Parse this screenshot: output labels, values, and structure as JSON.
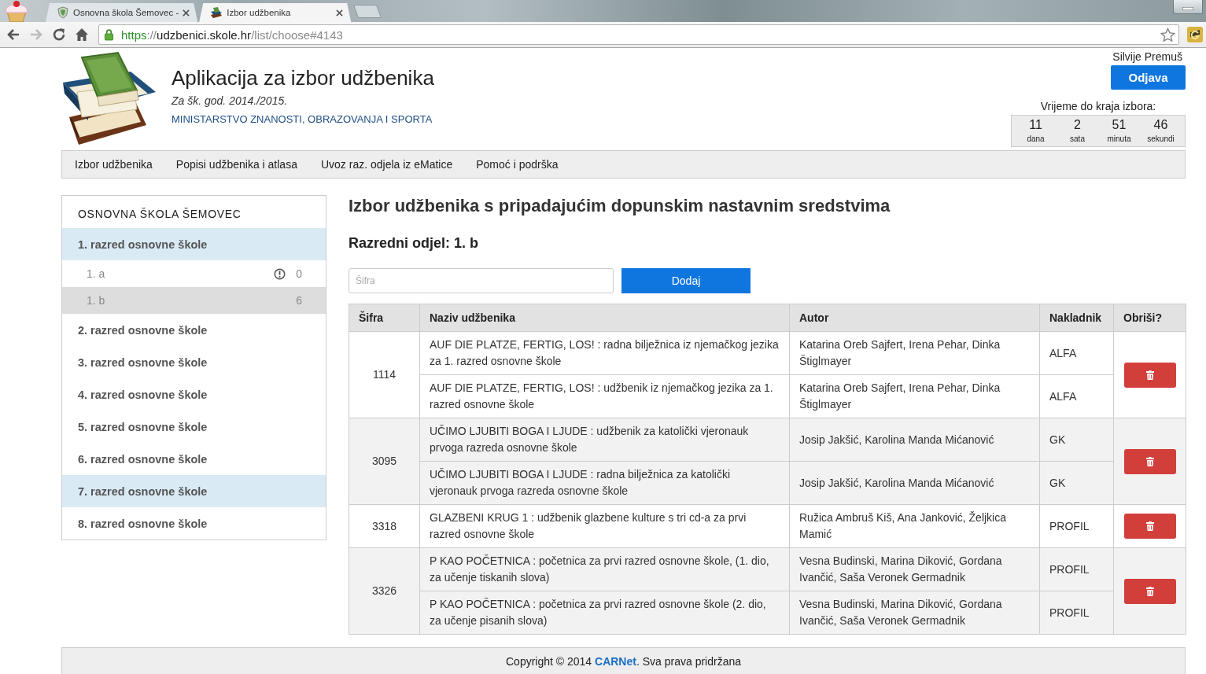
{
  "browser": {
    "tabs": [
      {
        "title": "Osnovna škola Šemovec -",
        "selected": false
      },
      {
        "title": "Izbor udžbenika",
        "selected": true
      }
    ],
    "nav_buttons": [
      {
        "kind": "back",
        "disabled": false
      },
      {
        "kind": "forward",
        "disabled": true
      },
      {
        "kind": "reload",
        "disabled": false
      },
      {
        "kind": "home",
        "disabled": false
      }
    ],
    "url": "https://udzbenici.skole.hr/list/choose#4143"
  },
  "header": {
    "title": "Aplikacija za izbor udžbenika",
    "school_year": "Za šk. god. 2014./2015.",
    "ministry": "MINISTARSTVO ZNANOSTI, OBRAZOVANJA I SPORTA",
    "user_name": "Silvije Premuš",
    "logout_button": "Odjava",
    "countdown": {
      "label": "Vrijeme do kraja izbora:",
      "parts": [
        {
          "value": "11",
          "unit": "dana"
        },
        {
          "value": "2",
          "unit": "sata"
        },
        {
          "value": "51",
          "unit": "minuta"
        },
        {
          "value": "46",
          "unit": "sekundi"
        }
      ]
    }
  },
  "nav": {
    "items": [
      "Izbor udžbenika",
      "Popisi udžbenika i atlasa",
      "Uvoz raz. odjela iz eMatice",
      "Pomoć i podrška"
    ]
  },
  "sidebar": {
    "school": "OSNOVNA ŠKOLA ŠEMOVEC",
    "grades": [
      {
        "label": "1. razred osnovne škole",
        "highlighted": true,
        "children": [
          {
            "label": "1. a",
            "count": "0",
            "warning": true,
            "selected": false
          },
          {
            "label": "1. b",
            "count": "6",
            "warning": false,
            "selected": true
          }
        ]
      },
      {
        "label": "2. razred osnovne škole",
        "highlighted": false
      },
      {
        "label": "3. razred osnovne škole",
        "highlighted": false
      },
      {
        "label": "4. razred osnovne škole",
        "highlighted": false
      },
      {
        "label": "5. razred osnovne škole",
        "highlighted": false
      },
      {
        "label": "6. razred osnovne škole",
        "highlighted": false
      },
      {
        "label": "7. razred osnovne škole",
        "highlighted": true
      },
      {
        "label": "8. razred osnovne škole",
        "highlighted": false
      }
    ]
  },
  "main": {
    "heading": "Izbor udžbenika s pripadajućim dopunskim nastavnim sredstvima",
    "class_heading": "Razredni odjel: 1. b",
    "code_field": {
      "placeholder": "Šifra"
    },
    "add_button": "Dodaj",
    "table": {
      "columns": [
        "Šifra",
        "Naziv udžbenika",
        "Autor",
        "Nakladnik",
        "Obriši?"
      ],
      "groups": [
        {
          "code": "1114",
          "rows": [
            {
              "title": "AUF DIE PLATZE, FERTIG, LOS! : radna bilježnica iz njemačkog jezika za 1. razred osnovne škole",
              "author": "Katarina Oreb Sajfert, Irena Pehar, Dinka Štiglmayer",
              "publisher": "ALFA"
            },
            {
              "title": "AUF DIE PLATZE, FERTIG, LOS! : udžbenik iz njemačkog jezika za 1. razred osnovne škole",
              "author": "Katarina Oreb Sajfert, Irena Pehar, Dinka Štiglmayer",
              "publisher": "ALFA"
            }
          ]
        },
        {
          "code": "3095",
          "rows": [
            {
              "title": "UČIMO LJUBITI BOGA I LJUDE : udžbenik za katolički vjeronauk prvoga razreda osnovne škole",
              "author": "Josip Jakšić, Karolina Manda Mićanović",
              "publisher": "GK"
            },
            {
              "title": "UČIMO LJUBITI BOGA I LJUDE : radna bilježnica za katolički vjeronauk prvoga razreda osnovne škole",
              "author": "Josip Jakšić, Karolina Manda Mićanović",
              "publisher": "GK"
            }
          ]
        },
        {
          "code": "3318",
          "rows": [
            {
              "title": "GLAZBENI KRUG 1 : udžbenik glazbene kulture s tri cd-a za prvi razred osnovne škole",
              "author": "Ružica Ambruš Kiš, Ana Janković, Željkica Mamić",
              "publisher": "PROFIL"
            }
          ]
        },
        {
          "code": "3326",
          "rows": [
            {
              "title": "P KAO POČETNICA : početnica za prvi razred osnovne škole, (1. dio, za učenje tiskanih slova)",
              "author": "Vesna Budinski, Marina Diković, Gordana Ivančić, Saša Veronek Germadnik",
              "publisher": "PROFIL"
            },
            {
              "title": "P KAO POČETNICA : početnica za prvi razred osnovne škole (2. dio, za učenje pisanih slova)",
              "author": "Vesna Budinski, Marina Diković, Gordana Ivančić, Saša Veronek Germadnik",
              "publisher": "PROFIL"
            }
          ]
        }
      ]
    }
  },
  "footer": {
    "text": "Copyright © 2014",
    "link": "CARNet",
    "rest": ". Sva prava pridržana"
  }
}
